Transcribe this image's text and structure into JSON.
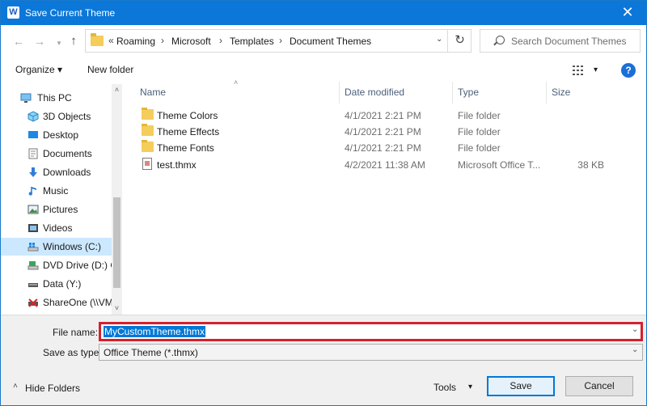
{
  "window": {
    "title": "Save Current Theme",
    "app_icon": "W",
    "close_glyph": "✕"
  },
  "nav": {
    "back": "←",
    "forward": "→",
    "up": "↑",
    "refresh": "↻"
  },
  "address": {
    "overflow": "«",
    "crumbs": [
      "Roaming",
      "Microsoft",
      "Templates",
      "Document Themes"
    ],
    "separator": "›",
    "dropdown": "⌄"
  },
  "search": {
    "placeholder": "Search Document Themes"
  },
  "toolbar": {
    "organize": "Organize ▾",
    "new_folder": "New folder",
    "view_dd": "▾",
    "help": "?"
  },
  "sidebar": {
    "items": [
      {
        "label": "This PC",
        "icon": "pc-icon"
      },
      {
        "label": "3D Objects",
        "icon": "cube-icon"
      },
      {
        "label": "Desktop",
        "icon": "desktop-icon"
      },
      {
        "label": "Documents",
        "icon": "documents-icon"
      },
      {
        "label": "Downloads",
        "icon": "download-icon"
      },
      {
        "label": "Music",
        "icon": "music-icon"
      },
      {
        "label": "Pictures",
        "icon": "pictures-icon"
      },
      {
        "label": "Videos",
        "icon": "videos-icon"
      },
      {
        "label": "Windows (C:)",
        "icon": "drive-icon"
      },
      {
        "label": "DVD Drive (D:) C",
        "icon": "dvd-icon"
      },
      {
        "label": "Data (Y:)",
        "icon": "network-drive-icon"
      },
      {
        "label": "ShareOne (\\\\VM",
        "icon": "network-share-icon"
      }
    ],
    "selected_index": 8,
    "scroll_up": "˄",
    "scroll_down": "˅"
  },
  "file_list": {
    "columns": [
      "Name",
      "Date modified",
      "Type",
      "Size"
    ],
    "sort_indicator": "˄",
    "rows": [
      {
        "name": "Theme Colors",
        "date": "4/1/2021 2:21 PM",
        "type": "File folder",
        "size": "",
        "icon": "folder-icon"
      },
      {
        "name": "Theme Effects",
        "date": "4/1/2021 2:21 PM",
        "type": "File folder",
        "size": "",
        "icon": "folder-icon"
      },
      {
        "name": "Theme Fonts",
        "date": "4/1/2021 2:21 PM",
        "type": "File folder",
        "size": "",
        "icon": "folder-icon"
      },
      {
        "name": "test.thmx",
        "date": "4/2/2021 11:38 AM",
        "type": "Microsoft Office T...",
        "size": "38 KB",
        "icon": "theme-file-icon"
      }
    ]
  },
  "form": {
    "file_name_label": "File name:",
    "file_name_value": "MyCustomTheme.thmx",
    "save_type_label": "Save as type:",
    "save_type_value": "Office Theme (*.thmx)",
    "dropdown_glyph": "⌄"
  },
  "footer": {
    "hide_folders": "Hide Folders",
    "hide_chevron": "˄",
    "tools": "Tools",
    "tools_dd": "▾",
    "save": "Save",
    "cancel": "Cancel"
  },
  "colors": {
    "titlebar": "#0a77d9",
    "accent": "#0078d7",
    "highlight": "#d6202c",
    "selected": "#cce8ff"
  }
}
